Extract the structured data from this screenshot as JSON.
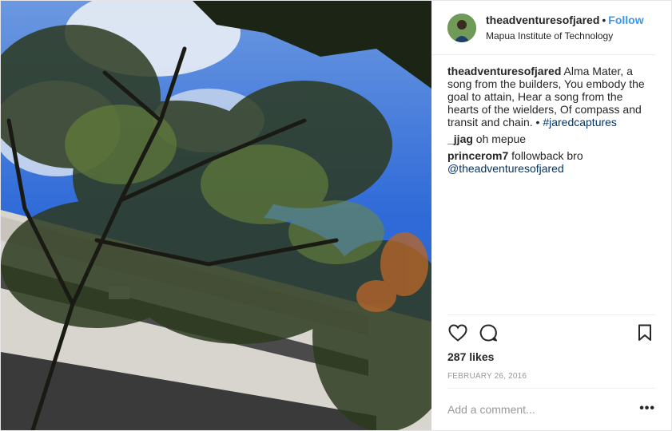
{
  "header": {
    "username": "theadventuresofjared",
    "separator": "•",
    "follow_label": "Follow",
    "location": "Mapua Institute of Technology"
  },
  "caption": {
    "username": "theadventuresofjared",
    "text": "Alma Mater, a song from the builders, You embody the goal to attain, Hear a song from the hearts of the wielders, Of compass and transit and chain. •",
    "hashtag": "#jaredcaptures"
  },
  "comments": [
    {
      "username": "_jjag",
      "text": "oh mepue"
    },
    {
      "username": "princerom7",
      "text": "followback bro",
      "mention": "@theadventuresofjared"
    }
  ],
  "actions": {
    "like_icon": "heart-icon",
    "comment_icon": "comment-bubble-icon",
    "save_icon": "bookmark-icon"
  },
  "likes": "287 likes",
  "date": "FEBRUARY 26, 2016",
  "add_comment": {
    "placeholder": "Add a comment...",
    "more_label": "•••"
  },
  "colors": {
    "link": "#003569",
    "follow": "#3897f0",
    "muted": "#999999",
    "border": "#efefef"
  }
}
